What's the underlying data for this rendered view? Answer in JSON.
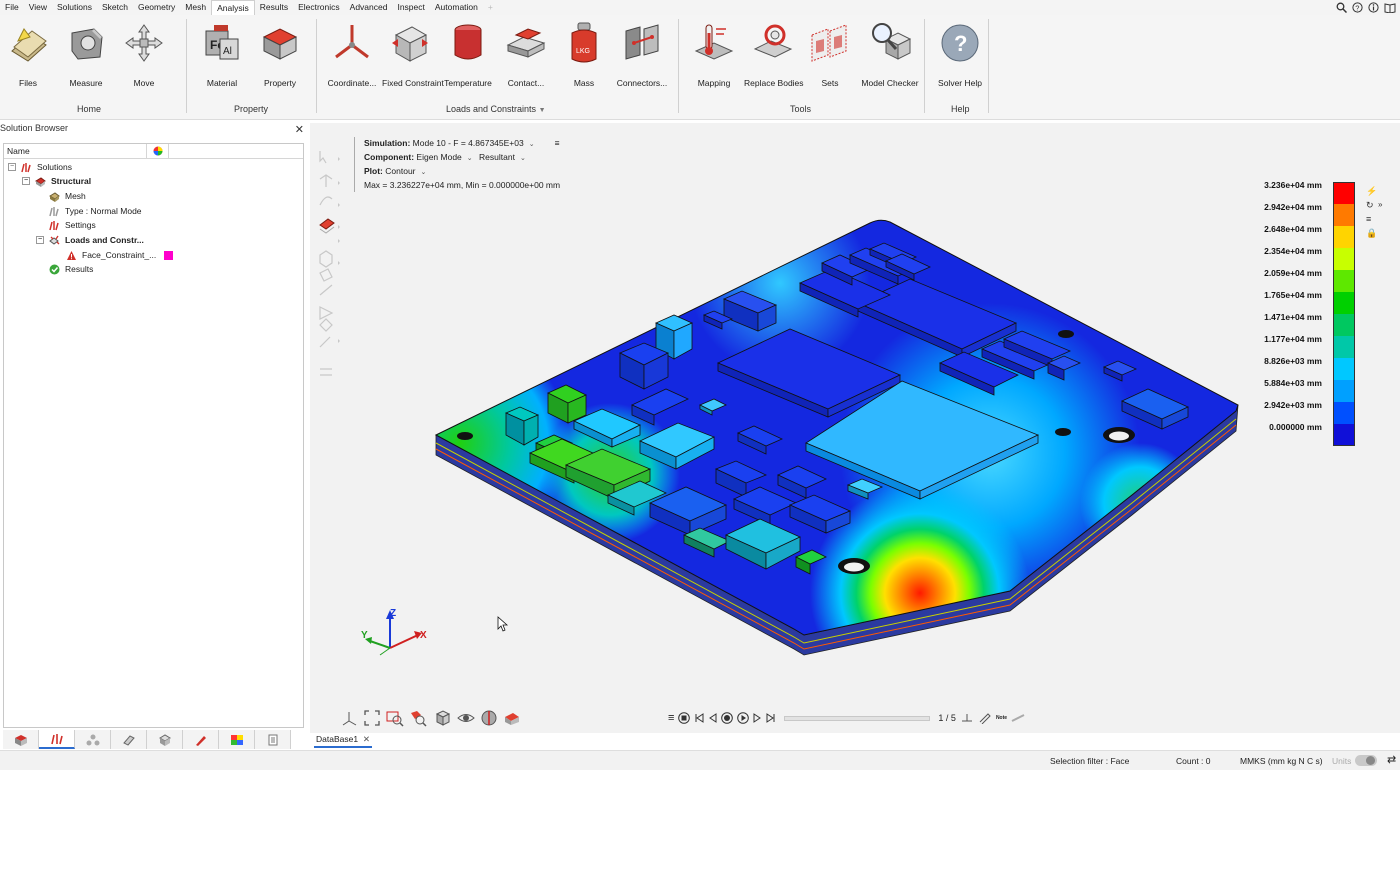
{
  "menu": {
    "items": [
      "File",
      "View",
      "Solutions",
      "Sketch",
      "Geometry",
      "Mesh",
      "Analysis",
      "Results",
      "Electronics",
      "Advanced",
      "Inspect",
      "Automation"
    ],
    "active": "Analysis",
    "add_tab": "+"
  },
  "ribbon": {
    "buttons": [
      {
        "label": "Files",
        "icon": "files-icon"
      },
      {
        "label": "Measure",
        "icon": "measure-icon"
      },
      {
        "label": "Move",
        "icon": "move-icon"
      },
      {
        "label": "Material",
        "icon": "material-icon"
      },
      {
        "label": "Property",
        "icon": "property-icon"
      },
      {
        "label": "Coordinate...",
        "icon": "coordinate-icon"
      },
      {
        "label": "Fixed Constraint",
        "icon": "fixed-constraint-icon"
      },
      {
        "label": "Temperature",
        "icon": "temperature-icon"
      },
      {
        "label": "Contact...",
        "icon": "contact-icon"
      },
      {
        "label": "Mass",
        "icon": "mass-icon"
      },
      {
        "label": "Connectors...",
        "icon": "connectors-icon"
      },
      {
        "label": "Mapping",
        "icon": "mapping-icon"
      },
      {
        "label": "Replace Bodies",
        "icon": "replace-bodies-icon"
      },
      {
        "label": "Sets",
        "icon": "sets-icon"
      },
      {
        "label": "Model Checker",
        "icon": "model-checker-icon"
      },
      {
        "label": "Solver Help",
        "icon": "solver-help-icon"
      }
    ],
    "groups": {
      "home": "Home",
      "property": "Property",
      "loads": "Loads and Constraints",
      "tools": "Tools",
      "help": "Help"
    },
    "mass_text": "LKG",
    "help_glyph": "?"
  },
  "solution_browser": {
    "title": "Solution Browser",
    "column_name": "Name",
    "tree": {
      "solutions": "Solutions",
      "structural": "Structural",
      "mesh": "Mesh",
      "type": "Type : Normal Mode",
      "settings": "Settings",
      "loads": "Loads and Constr...",
      "face_constraint": "Face_Constraint_...",
      "results": "Results"
    },
    "face_constraint_color": "#ff00cc"
  },
  "viewport": {
    "simulation_label": "Simulation:",
    "simulation_value": "Mode 10 - F = 4.867345E+03",
    "component_label": "Component:",
    "component_value": "Eigen Mode",
    "component_value2": "Resultant",
    "plot_label": "Plot:",
    "plot_value": "Contour",
    "max_min": "Max = 3.236227e+04 mm, Min = 0.000000e+00 mm",
    "axes": {
      "x": "X",
      "y": "Y",
      "z": "Z"
    }
  },
  "legend": {
    "labels": [
      "3.236e+04 mm",
      "2.942e+04 mm",
      "2.648e+04 mm",
      "2.354e+04 mm",
      "2.059e+04 mm",
      "1.765e+04 mm",
      "1.471e+04 mm",
      "1.177e+04 mm",
      "8.826e+03 mm",
      "5.884e+03 mm",
      "2.942e+03 mm",
      "0.000000 mm"
    ],
    "colors": [
      "#ff0000",
      "#ff7a00",
      "#ffd400",
      "#c8ff00",
      "#5ee800",
      "#00d000",
      "#00c860",
      "#00c8a8",
      "#00c8ff",
      "#00a0ff",
      "#0050ff",
      "#1010d8"
    ]
  },
  "animation": {
    "frame": "1 / 5",
    "note_label": "Note"
  },
  "doc_tab": {
    "label": "DataBase1"
  },
  "status": {
    "selection_filter": "Selection filter : Face",
    "count": "Count : 0",
    "units_system": "MMKS (mm kg N C s)",
    "units_label": "Units"
  }
}
